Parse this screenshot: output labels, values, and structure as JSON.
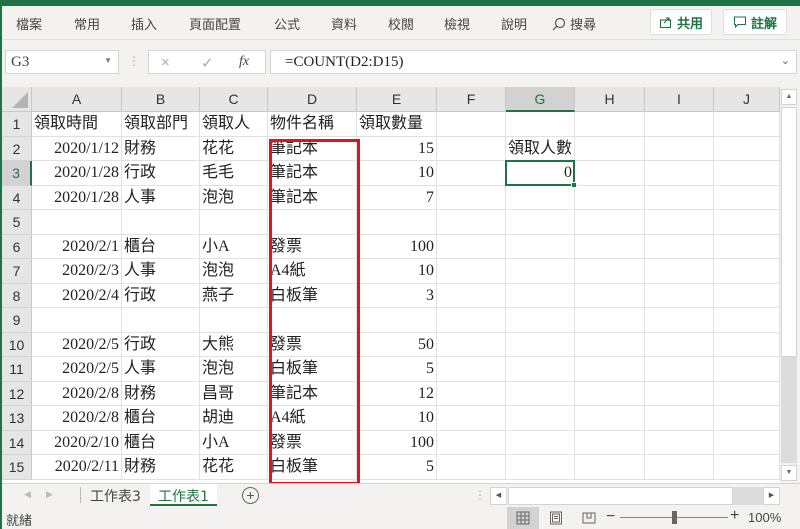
{
  "ribbon": {
    "tabs": [
      "檔案",
      "常用",
      "插入",
      "頁面配置",
      "公式",
      "資料",
      "校閱",
      "檢視",
      "說明"
    ],
    "search_label": "搜尋",
    "share_label": "共用",
    "comment_label": "註解"
  },
  "formula_bar": {
    "name_box": "G3",
    "cancel_icon": "×",
    "enter_icon": "✓",
    "fx_label": "fx",
    "formula": "=COUNT(D2:D15)"
  },
  "sheet": {
    "columns": [
      "A",
      "B",
      "C",
      "D",
      "E",
      "F",
      "G",
      "H",
      "I",
      "J"
    ],
    "selected_column": "G",
    "selected_row": "3",
    "selected_cell": "G3",
    "rows": [
      {
        "num": "1",
        "A": "領取時間",
        "B": "領取部門",
        "C": "領取人",
        "D": "物件名稱",
        "E": "領取數量",
        "G": ""
      },
      {
        "num": "2",
        "A": "2020/1/12",
        "B": "財務",
        "C": "花花",
        "D": "筆記本",
        "E": "15",
        "G": "領取人數"
      },
      {
        "num": "3",
        "A": "2020/1/28",
        "B": "行政",
        "C": "毛毛",
        "D": "筆記本",
        "E": "10",
        "G": "0"
      },
      {
        "num": "4",
        "A": "2020/1/28",
        "B": "人事",
        "C": "泡泡",
        "D": "筆記本",
        "E": "7",
        "G": ""
      },
      {
        "num": "5",
        "A": "",
        "B": "",
        "C": "",
        "D": "",
        "E": "",
        "G": ""
      },
      {
        "num": "6",
        "A": "2020/2/1",
        "B": "櫃台",
        "C": "小A",
        "D": "發票",
        "E": "100",
        "G": ""
      },
      {
        "num": "7",
        "A": "2020/2/3",
        "B": "人事",
        "C": "泡泡",
        "D": "A4紙",
        "E": "10",
        "G": ""
      },
      {
        "num": "8",
        "A": "2020/2/4",
        "B": "行政",
        "C": "燕子",
        "D": "白板筆",
        "E": "3",
        "G": ""
      },
      {
        "num": "9",
        "A": "",
        "B": "",
        "C": "",
        "D": "",
        "E": "",
        "G": ""
      },
      {
        "num": "10",
        "A": "2020/2/5",
        "B": "行政",
        "C": "大熊",
        "D": "發票",
        "E": "50",
        "G": ""
      },
      {
        "num": "11",
        "A": "2020/2/5",
        "B": "人事",
        "C": "泡泡",
        "D": "白板筆",
        "E": "5",
        "G": ""
      },
      {
        "num": "12",
        "A": "2020/2/8",
        "B": "財務",
        "C": "昌哥",
        "D": "筆記本",
        "E": "12",
        "G": ""
      },
      {
        "num": "13",
        "A": "2020/2/8",
        "B": "櫃台",
        "C": "胡迪",
        "D": "A4紙",
        "E": "10",
        "G": ""
      },
      {
        "num": "14",
        "A": "2020/2/10",
        "B": "櫃台",
        "C": "小A",
        "D": "發票",
        "E": "100",
        "G": ""
      },
      {
        "num": "15",
        "A": "2020/2/11",
        "B": "財務",
        "C": "花花",
        "D": "白板筆",
        "E": "5",
        "G": ""
      }
    ],
    "highlight_color": "#e0141e",
    "accent_color": "#217346"
  },
  "sheet_tabs": {
    "tabs": [
      "工作表3",
      "工作表1"
    ],
    "active": "工作表1",
    "add_icon": "+"
  },
  "status_bar": {
    "status": "就緒",
    "zoom_minus": "−",
    "zoom_plus": "+",
    "zoom_level": "100%",
    "zoom_percent": 100
  }
}
